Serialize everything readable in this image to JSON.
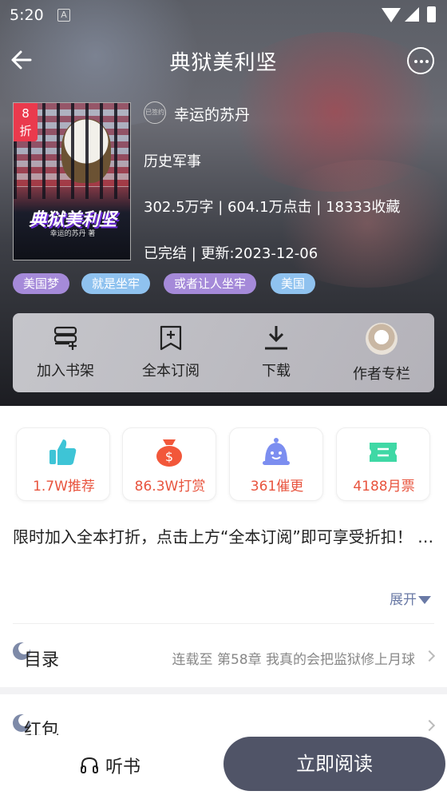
{
  "status": {
    "time": "5:20",
    "a_icon": "A"
  },
  "header": {
    "title": "典狱美利坚"
  },
  "book": {
    "cover_title": "典狱美利坚",
    "cover_author": "幸运的苏丹 著",
    "discount": [
      "8",
      "折"
    ],
    "signed_badge": "已签约",
    "author": "幸运的苏丹",
    "category": "历史军事",
    "stats_line": "302.5万字 | 604.1万点击 | 18333收藏",
    "update_line": "已完结 | 更新:2023-12-06",
    "tags": [
      {
        "label": "美国梦",
        "color": "#a58ad9"
      },
      {
        "label": "就是坐牢",
        "color": "#8fc2ef"
      },
      {
        "label": "或者让人坐牢",
        "color": "#a58ad9"
      },
      {
        "label": "美国",
        "color": "#8fc2ef"
      }
    ]
  },
  "actions": [
    {
      "label": "加入书架",
      "icon": "bookshelf-icon"
    },
    {
      "label": "全本订阅",
      "icon": "subscribe-icon"
    },
    {
      "label": "下载",
      "icon": "download-icon"
    },
    {
      "label": "作者专栏",
      "icon": "avatar"
    }
  ],
  "stats": [
    {
      "label": "1.7W推荐",
      "icon": "thumbs-up-icon",
      "color": "#3ec4d6"
    },
    {
      "label": "86.3W打赏",
      "icon": "money-bag-icon",
      "color": "#f2573a"
    },
    {
      "label": "361催更",
      "icon": "bell-face-icon",
      "color": "#7c8ef0"
    },
    {
      "label": "4188月票",
      "icon": "ticket-icon",
      "color": "#3fd8a5"
    }
  ],
  "intro": {
    "text": "限时加入全本打折，点击上方“全本订阅”即可享受折扣！ …",
    "expand": "展开"
  },
  "toc": {
    "title": "目录",
    "latest": "连载至 第58章  我真的会把监狱修上月球"
  },
  "redpacket": {
    "title": "红包"
  },
  "bottom": {
    "listen": "听书",
    "read": "立即阅读"
  }
}
